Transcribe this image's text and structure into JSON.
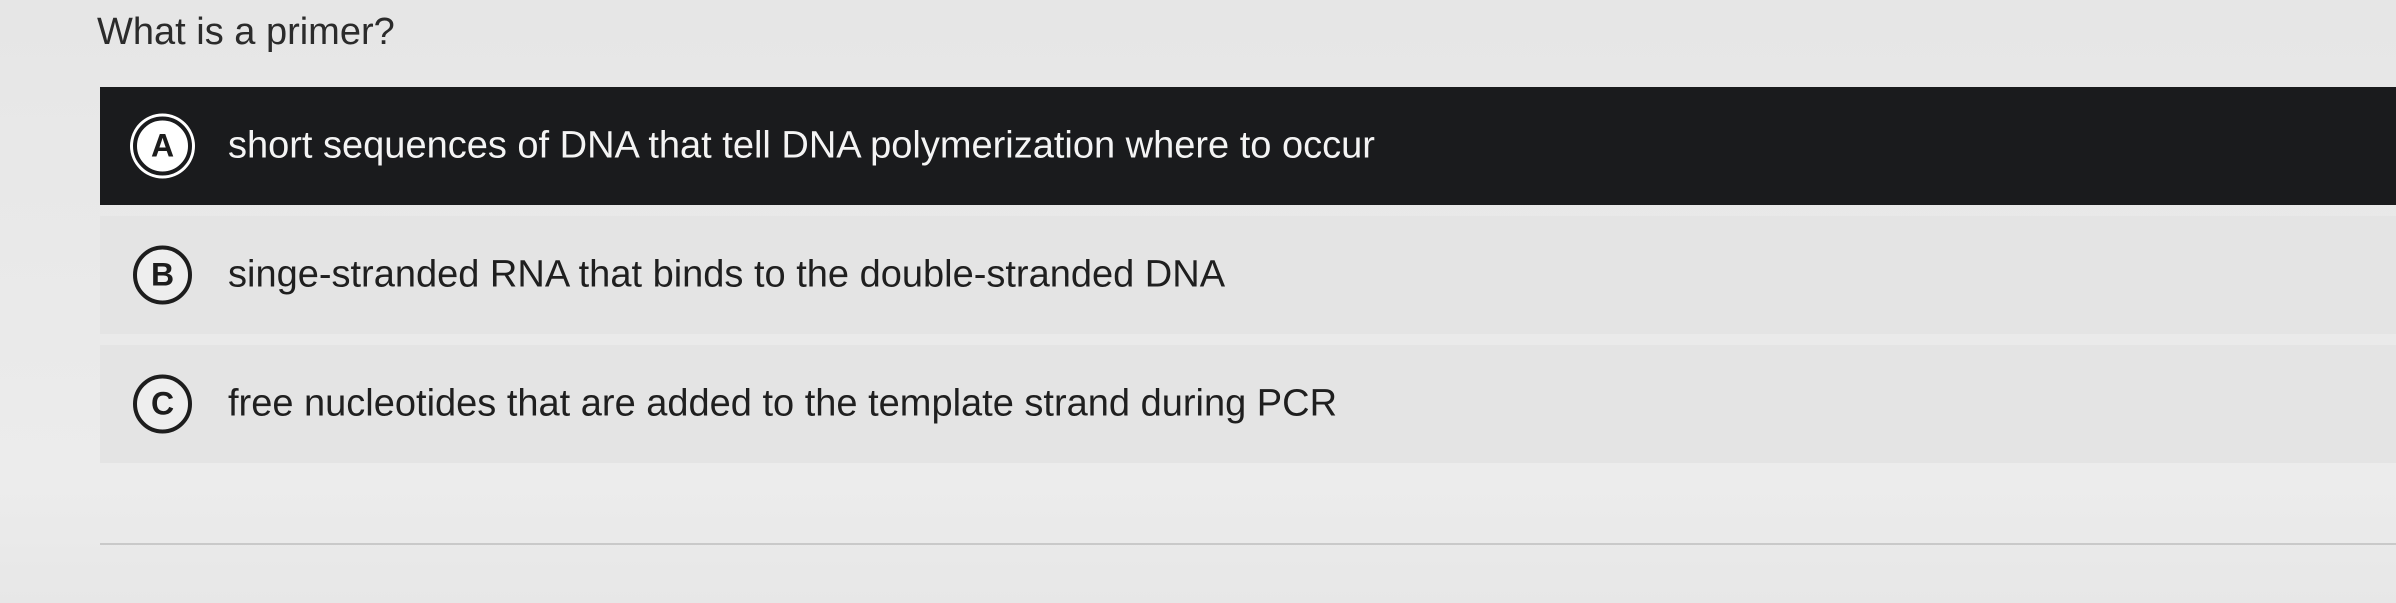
{
  "question": {
    "text": "What is a primer?"
  },
  "options": [
    {
      "letter": "A",
      "text": "short sequences of DNA that tell DNA polymerization where to occur",
      "selected": true
    },
    {
      "letter": "B",
      "text": "singe-stranded RNA that binds to the double-stranded DNA",
      "selected": false
    },
    {
      "letter": "C",
      "text": "free nucleotides that are added to the template strand during PCR",
      "selected": false
    }
  ],
  "colors": {
    "selected_background": "#1a1b1d",
    "option_background": "#e4e4e4",
    "page_background": "#e8e8e8"
  }
}
